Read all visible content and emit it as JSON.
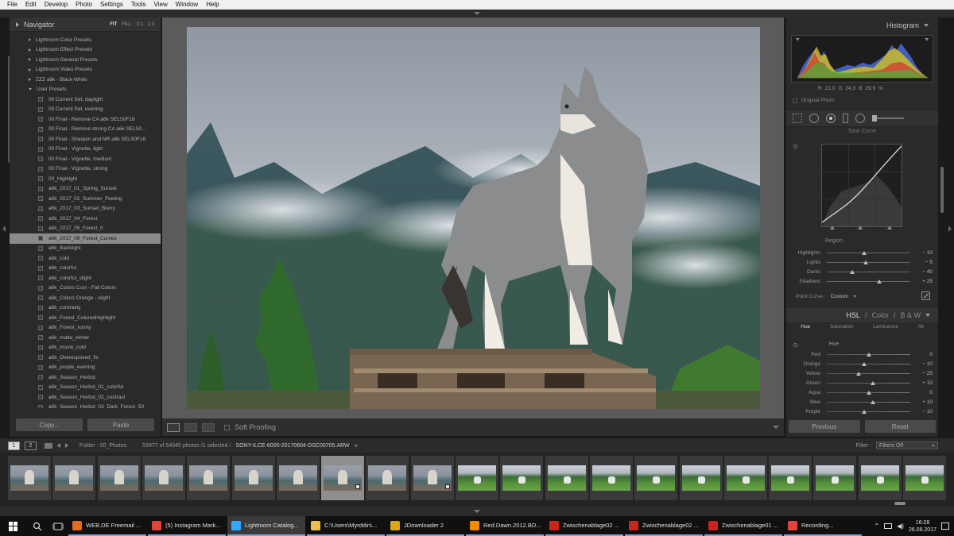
{
  "menu": [
    "File",
    "Edit",
    "Develop",
    "Photo",
    "Settings",
    "Tools",
    "View",
    "Window",
    "Help"
  ],
  "left_panel": {
    "navigator_title": "Navigator",
    "zoom_options": [
      "FIT",
      "FILL",
      "1:1",
      "1:3"
    ],
    "presets": [
      {
        "label": "Lightroom Color Presets",
        "type": "folder"
      },
      {
        "label": "Lightroom Effect Presets",
        "type": "folder"
      },
      {
        "label": "Lightroom General Presets",
        "type": "folder"
      },
      {
        "label": "Lightroom Video Presets",
        "type": "folder"
      },
      {
        "label": "ZZZ a6k - Black-White",
        "type": "folder"
      },
      {
        "label": "User Presets",
        "type": "folder-open"
      },
      {
        "label": "00 Current Set, daylight",
        "type": "item"
      },
      {
        "label": "00 Current Set, evening",
        "type": "item"
      },
      {
        "label": "00 Final - Remove CA a6k SEL50F18",
        "type": "item"
      },
      {
        "label": "00 Final - Remove strong CA a6k SEL50...",
        "type": "item"
      },
      {
        "label": "00 Final - Sharpen and NR a6k SEL50F18",
        "type": "item"
      },
      {
        "label": "00 Final - Vignette, light",
        "type": "item"
      },
      {
        "label": "00 Final - Vignette, medium",
        "type": "item"
      },
      {
        "label": "00 Final - Vignette, strong",
        "type": "item"
      },
      {
        "label": "00_Highlight",
        "type": "item"
      },
      {
        "label": "a6k_2017_01_Spring_Sunset",
        "type": "item"
      },
      {
        "label": "a6k_2017_02_Summer_Feeling",
        "type": "item"
      },
      {
        "label": "a6k_2017_03_Sunset_Blurry",
        "type": "item"
      },
      {
        "label": "a6k_2017_04_Forest",
        "type": "item"
      },
      {
        "label": "a6k_2017_05_Forest_II",
        "type": "item"
      },
      {
        "label": "a6k_2017_08_Forest_Curves",
        "type": "item",
        "selected": true
      },
      {
        "label": "a6k_Backlight",
        "type": "item"
      },
      {
        "label": "a6k_cold",
        "type": "item"
      },
      {
        "label": "a6k_colorful",
        "type": "item"
      },
      {
        "label": "a6k_colorful_slight",
        "type": "item"
      },
      {
        "label": "a6k_Colors Cool - Fall Colors",
        "type": "item"
      },
      {
        "label": "a6k_Colors Orange - slight",
        "type": "item"
      },
      {
        "label": "a6k_contrasty",
        "type": "item"
      },
      {
        "label": "a6k_Forest_ColoredHighlight",
        "type": "item"
      },
      {
        "label": "a6k_Forest_sunny",
        "type": "item"
      },
      {
        "label": "a6k_matte_winter",
        "type": "item"
      },
      {
        "label": "a6k_movie_cold",
        "type": "item"
      },
      {
        "label": "a6k_Overexposed_fix",
        "type": "item"
      },
      {
        "label": "a6k_purple_evening",
        "type": "item"
      },
      {
        "label": "a6k_Season_Herbst",
        "type": "item"
      },
      {
        "label": "a6k_Season_Herbst_01_colorful",
        "type": "item"
      },
      {
        "label": "a6k_Season_Herbst_02_contrast",
        "type": "item"
      },
      {
        "label": "a6k_Season_Herbst_03_Dark_Forest_50",
        "type": "item"
      }
    ],
    "copy_label": "Copy...",
    "paste_label": "Paste"
  },
  "toolbar": {
    "soft_proofing": "Soft Proofing"
  },
  "right_panel": {
    "histogram_title": "Histogram",
    "readout": {
      "r_label": "R",
      "r": "21,0",
      "g_label": "G",
      "g": "24,3",
      "b_label": "B",
      "b": "29,9",
      "pct": "%"
    },
    "original_photo": "Original Photo",
    "tone_curve_title": "Tone Curve",
    "region_title": "Region",
    "region_sliders": [
      {
        "label": "Highlights",
        "value": "− 10",
        "pos": 0.45
      },
      {
        "label": "Lights",
        "value": "− 5",
        "pos": 0.47
      },
      {
        "label": "Darks",
        "value": "− 40",
        "pos": 0.3
      },
      {
        "label": "Shadows",
        "value": "+ 25",
        "pos": 0.63
      }
    ],
    "point_curve_label": "Point Curve :",
    "point_curve_value": "Custom",
    "hsl_tabs_head": [
      "HSL",
      "/",
      "Color",
      "/",
      "B & W"
    ],
    "hsl_tabs": [
      "Hue",
      "Saturation",
      "Luminance",
      "All"
    ],
    "hue_title": "Hue",
    "hue_sliders": [
      {
        "label": "Red",
        "value": "0",
        "pos": 0.5
      },
      {
        "label": "Orange",
        "value": "− 10",
        "pos": 0.45
      },
      {
        "label": "Yellow",
        "value": "− 25",
        "pos": 0.38
      },
      {
        "label": "Green",
        "value": "+ 10",
        "pos": 0.55
      },
      {
        "label": "Aqua",
        "value": "0",
        "pos": 0.5
      },
      {
        "label": "Blue",
        "value": "+ 10",
        "pos": 0.55
      },
      {
        "label": "Purple",
        "value": "− 10",
        "pos": 0.45
      }
    ],
    "previous_label": "Previous",
    "reset_label": "Reset"
  },
  "filmstrip": {
    "pages": [
      "1",
      "2"
    ],
    "folder": "Folder : 00_Photos",
    "count": "53977 of 54045 photos /1 selected /",
    "file": "SONY-ILCE-6000-20170604-DSC00705.ARW",
    "filter_label": "Filter :",
    "filter_value": "Filters Off",
    "thumbs": [
      "wolf",
      "wolf",
      "wolf",
      "wolf",
      "wolf",
      "wolf",
      "wolf",
      "wolf-sel",
      "wolf",
      "wolf-badge",
      "field",
      "field",
      "field",
      "field",
      "field",
      "field",
      "field",
      "field",
      "field",
      "field",
      "field"
    ]
  },
  "taskbar": {
    "apps": [
      {
        "label": "WEB.DE Freemail ...",
        "color": "#e66a1e"
      },
      {
        "label": "(5) Instagram Mark...",
        "color": "#db4437"
      },
      {
        "label": "Lightroom Catalog...",
        "color": "#31a8ff",
        "active": true
      },
      {
        "label": "C:\\Users\\Myrddin\\...",
        "color": "#e8c14a"
      },
      {
        "label": "JDownloader 2",
        "color": "#d8a818"
      },
      {
        "label": "Red.Dawn.2012.BD...",
        "color": "#f08a00"
      },
      {
        "label": "Zwischenablage02 ...",
        "color": "#c8261c"
      },
      {
        "label": "Zwischenablage02 ...",
        "color": "#c8261c"
      },
      {
        "label": "Zwischenablage01 ...",
        "color": "#c8261c"
      },
      {
        "label": "Recording...",
        "color": "#e0443a"
      }
    ],
    "time": "16:28",
    "date": "26.08.2017"
  }
}
